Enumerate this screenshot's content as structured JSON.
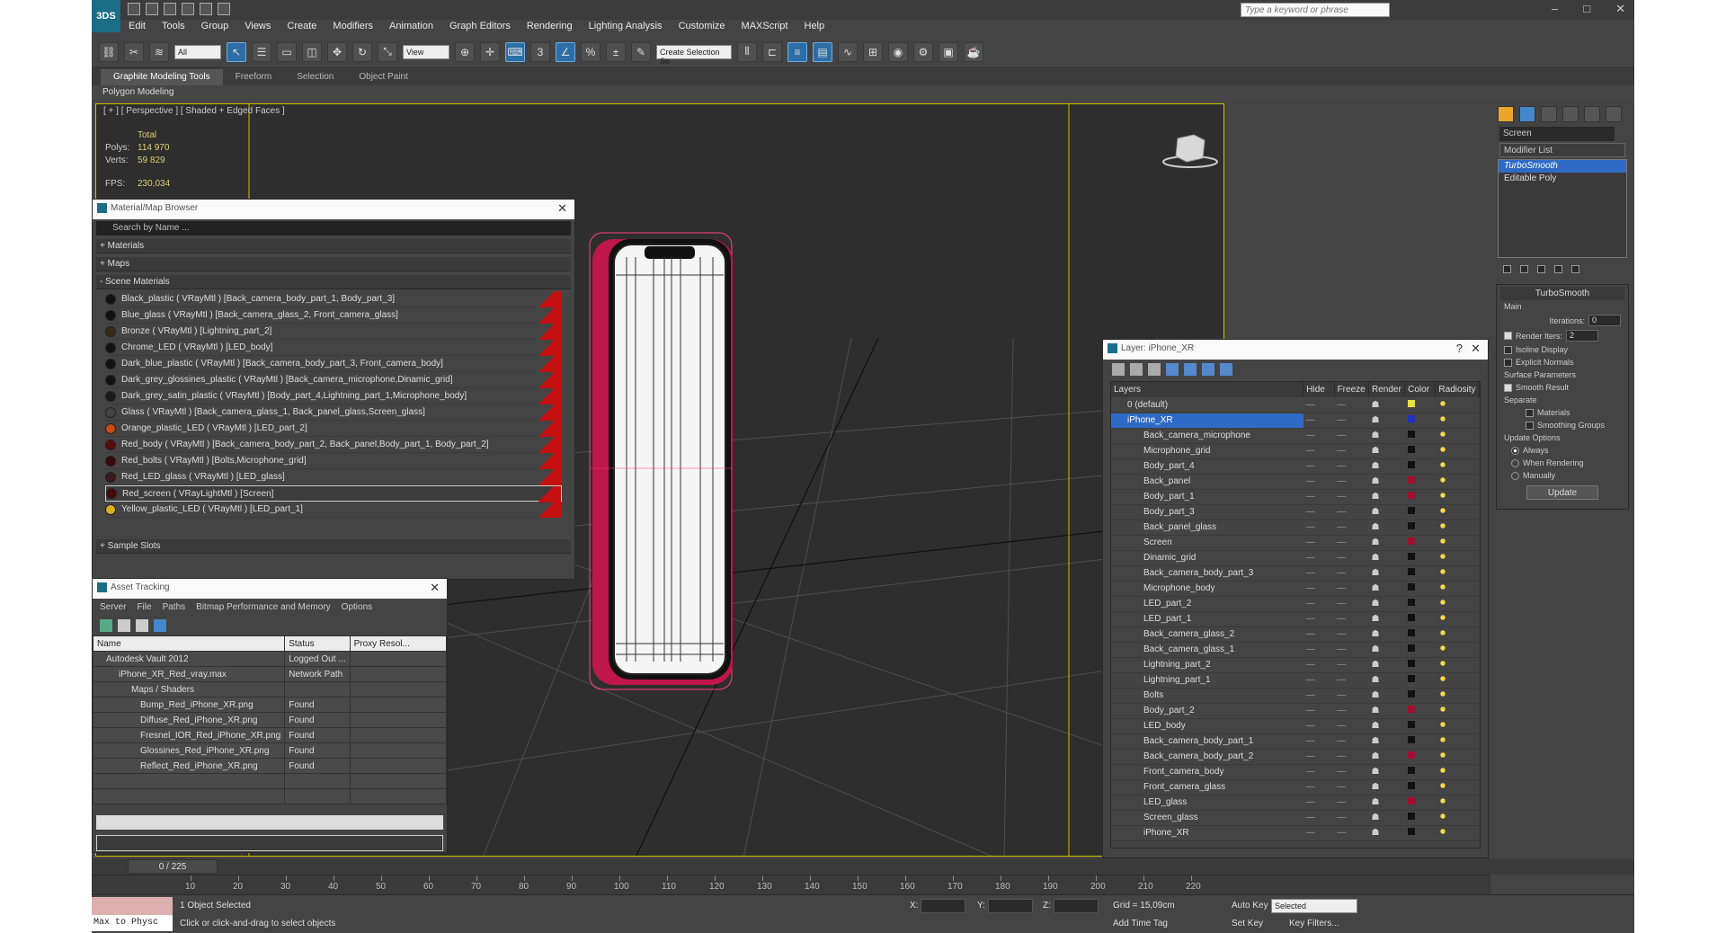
{
  "app": {
    "logo": "3DS",
    "search_placeholder": "Type a keyword or phrase",
    "menu": [
      "Edit",
      "Tools",
      "Group",
      "Views",
      "Create",
      "Modifiers",
      "Animation",
      "Graph Editors",
      "Rendering",
      "Lighting Analysis",
      "Customize",
      "MAXScript",
      "Help"
    ],
    "selection_filter": "All",
    "ref_coord": "View",
    "named_selection": "Create Selection Se"
  },
  "ribbon": {
    "tabs": [
      "Graphite Modeling Tools",
      "Freeform",
      "Selection",
      "Object Paint"
    ],
    "sub": "Polygon Modeling"
  },
  "viewport": {
    "label": "[ + ] [ Perspective ] [ Shaded + Edged Faces ]",
    "stats": {
      "total": "Total",
      "polys_label": "Polys:",
      "polys": "114 970",
      "verts_label": "Verts:",
      "verts": "59 829",
      "fps_label": "FPS:",
      "fps": "230,034"
    },
    "grid": {
      "show": true
    }
  },
  "material_browser": {
    "title": "Material/Map Browser",
    "search": "Search by Name ...",
    "sections": [
      "+ Materials",
      "+ Maps",
      "- Scene Materials"
    ],
    "materials": [
      {
        "name": "Black_plastic ( VRayMtl ) [Back_camera_body_part_1, Body_part_3]",
        "color": "#111111"
      },
      {
        "name": "Blue_glass ( VRayMtl ) [Back_camera_glass_2, Front_camera_glass]",
        "color": "#111111"
      },
      {
        "name": "Bronze ( VRayMtl ) [Lightning_part_2]",
        "color": "#3a2a18"
      },
      {
        "name": "Chrome_LED ( VRayMtl ) [LED_body]",
        "color": "#111111"
      },
      {
        "name": "Dark_blue_plastic ( VRayMtl ) [Back_camera_body_part_3, Front_camera_body]",
        "color": "#111111"
      },
      {
        "name": "Dark_grey_glossines_plastic ( VRayMtl ) [Back_camera_microphone,Dinamic_grid]",
        "color": "#111111"
      },
      {
        "name": "Dark_grey_satin_plastic ( VRayMtl ) [Body_part_4,Lightning_part_1,Microphone_body]",
        "color": "#1a1a1a"
      },
      {
        "name": "Glass ( VRayMtl ) [Back_camera_glass_1, Back_panel_glass,Screen_glass]",
        "color": "#444444"
      },
      {
        "name": "Orange_plastic_LED ( VRayMtl ) [LED_part_2]",
        "color": "#c84a10"
      },
      {
        "name": "Red_body ( VRayMtl ) [Back_camera_body_part_2, Back_panel,Body_part_1, Body_part_2]",
        "color": "#5a0a0a"
      },
      {
        "name": "Red_bolts ( VRayMtl ) [Bolts,Microphone_grid]",
        "color": "#3a0808"
      },
      {
        "name": "Red_LED_glass ( VRayMtl ) [LED_glass]",
        "color": "#3a1a1a"
      },
      {
        "name": "Red_screen ( VRayLightMtl ) [Screen]",
        "color": "#4a0808"
      },
      {
        "name": "Yellow_plastic_LED ( VRayMtl ) [LED_part_1]",
        "color": "#d8b020"
      }
    ],
    "sample_slots": "+ Sample Slots"
  },
  "asset_tracking": {
    "title": "Asset Tracking",
    "menu": [
      "Server",
      "File",
      "Paths",
      "Bitmap Performance and Memory",
      "Options"
    ],
    "columns": [
      "Name",
      "Status",
      "Proxy Resol..."
    ],
    "rows": [
      {
        "name": "Autodesk Vault 2012",
        "status": "Logged Out ...",
        "proxy": ""
      },
      {
        "name": "iPhone_XR_Red_vray.max",
        "status": "Network Path",
        "proxy": ""
      },
      {
        "name": "Maps / Shaders",
        "status": "",
        "proxy": ""
      },
      {
        "name": "Bump_Red_iPhone_XR.png",
        "status": "Found",
        "proxy": ""
      },
      {
        "name": "Diffuse_Red_iPhone_XR.png",
        "status": "Found",
        "proxy": ""
      },
      {
        "name": "Fresnel_IOR_Red_iPhone_XR.png",
        "status": "Found",
        "proxy": ""
      },
      {
        "name": "Glossines_Red_iPhone_XR.png",
        "status": "Found",
        "proxy": ""
      },
      {
        "name": "Reflect_Red_iPhone_XR.png",
        "status": "Found",
        "proxy": ""
      }
    ]
  },
  "layer_explorer": {
    "title": "Layer: iPhone_XR",
    "columns": [
      "Layers",
      "Hide",
      "Freeze",
      "Render",
      "Color",
      "Radiosity"
    ],
    "rows": [
      {
        "name": "0 (default)",
        "color": "#e8e040",
        "sel": false
      },
      {
        "name": "iPhone_XR",
        "color": "#2030c0",
        "sel": true
      },
      {
        "name": "Back_camera_microphone",
        "color": "#111111",
        "sel": false
      },
      {
        "name": "Microphone_grid",
        "color": "#111111",
        "sel": false
      },
      {
        "name": "Body_part_4",
        "color": "#111111",
        "sel": false
      },
      {
        "name": "Back_panel",
        "color": "#a01030",
        "sel": false
      },
      {
        "name": "Body_part_1",
        "color": "#a01030",
        "sel": false
      },
      {
        "name": "Body_part_3",
        "color": "#111111",
        "sel": false
      },
      {
        "name": "Back_panel_glass",
        "color": "#111111",
        "sel": false
      },
      {
        "name": "Screen",
        "color": "#a01030",
        "sel": false
      },
      {
        "name": "Dinamic_grid",
        "color": "#111111",
        "sel": false
      },
      {
        "name": "Back_camera_body_part_3",
        "color": "#111111",
        "sel": false
      },
      {
        "name": "Microphone_body",
        "color": "#111111",
        "sel": false
      },
      {
        "name": "LED_part_2",
        "color": "#111111",
        "sel": false
      },
      {
        "name": "LED_part_1",
        "color": "#111111",
        "sel": false
      },
      {
        "name": "Back_camera_glass_2",
        "color": "#111111",
        "sel": false
      },
      {
        "name": "Back_camera_glass_1",
        "color": "#111111",
        "sel": false
      },
      {
        "name": "Lightning_part_2",
        "color": "#111111",
        "sel": false
      },
      {
        "name": "Lightning_part_1",
        "color": "#111111",
        "sel": false
      },
      {
        "name": "Bolts",
        "color": "#111111",
        "sel": false
      },
      {
        "name": "Body_part_2",
        "color": "#a01030",
        "sel": false
      },
      {
        "name": "LED_body",
        "color": "#111111",
        "sel": false
      },
      {
        "name": "Back_camera_body_part_1",
        "color": "#111111",
        "sel": false
      },
      {
        "name": "Back_camera_body_part_2",
        "color": "#a01030",
        "sel": false
      },
      {
        "name": "Front_camera_body",
        "color": "#111111",
        "sel": false
      },
      {
        "name": "Front_camera_glass",
        "color": "#111111",
        "sel": false
      },
      {
        "name": "LED_glass",
        "color": "#a01030",
        "sel": false
      },
      {
        "name": "Screen_glass",
        "color": "#111111",
        "sel": false
      },
      {
        "name": "iPhone_XR",
        "color": "#111111",
        "sel": false
      }
    ]
  },
  "command_panel": {
    "object_name": "Screen",
    "modifier_list": "Modifier List",
    "stack": [
      "TurboSmooth",
      "Editable Poly"
    ],
    "turbosmooth": {
      "title": "TurboSmooth",
      "main": "Main",
      "iterations_label": "Iterations:",
      "iterations": "0",
      "render_iters_label": "Render Iters:",
      "render_iters": "2",
      "isoline": "Isoline Display",
      "explicit": "Explicit Normals",
      "surface": "Surface Parameters",
      "smooth": "Smooth Result",
      "separate": "Separate",
      "materials": "Materials",
      "smoothing": "Smoothing Groups",
      "update_options": "Update Options",
      "always": "Always",
      "when_rendering": "When Rendering",
      "manually": "Manually",
      "update_btn": "Update"
    }
  },
  "timeline": {
    "frame": "0 / 225",
    "ticks": [
      "10",
      "20",
      "30",
      "40",
      "50",
      "60",
      "70",
      "80",
      "90",
      "100",
      "110",
      "120",
      "130",
      "140",
      "150",
      "160",
      "170",
      "180",
      "190",
      "200",
      "210",
      "220"
    ]
  },
  "status": {
    "maxscript": "Max to Physc",
    "selected": "1 Object Selected",
    "prompt": "Click or click-and-drag to select objects",
    "x": "X:",
    "y": "Y:",
    "z": "Z:",
    "grid": "Grid = 15,09cm",
    "add_time_tag": "Add Time Tag",
    "auto_key": "Auto Key",
    "set_key": "Set Key",
    "selected_dd": "Selected",
    "key_filters": "Key Filters..."
  }
}
